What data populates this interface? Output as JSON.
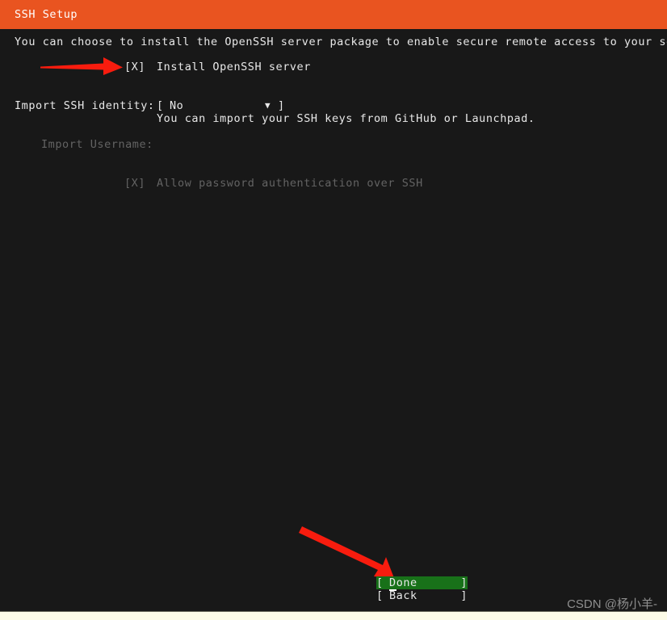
{
  "window": {
    "title": "SSH Setup",
    "accent_color": "#e95420",
    "background_color": "#181818",
    "text_color": "#e8e8e8",
    "dim_text_color": "#636363",
    "highlight_color": "#187119",
    "annotation_color": "#f81c0e"
  },
  "content": {
    "description": "You can choose to install the OpenSSH server package to enable secure remote access to your server.",
    "install_checkbox": {
      "state": "[X]",
      "label": "Install OpenSSH server",
      "checked": true
    },
    "import_identity": {
      "label": "Import SSH identity:",
      "open_bracket": "[",
      "value": "No",
      "arrow_glyph": "▼",
      "close_bracket": "]",
      "help": "You can import your SSH keys from GitHub or Launchpad."
    },
    "import_username": {
      "label": "Import Username:",
      "value": "",
      "enabled": false
    },
    "allow_password_auth": {
      "state": "[X]",
      "label": "Allow password authentication over SSH",
      "checked": true,
      "enabled": false
    }
  },
  "buttons": [
    {
      "name": "done",
      "open_bracket": "[",
      "label": "Done",
      "close_bracket": "]",
      "selected": true
    },
    {
      "name": "back",
      "open_bracket": "[",
      "label": "Back",
      "close_bracket": "]",
      "selected": false
    }
  ],
  "annotations": {
    "arrow_to_checkbox": "red-arrow-pointing-right",
    "arrow_to_done": "red-arrow-pointing-down-right"
  },
  "watermark": "CSDN @杨小羊-"
}
